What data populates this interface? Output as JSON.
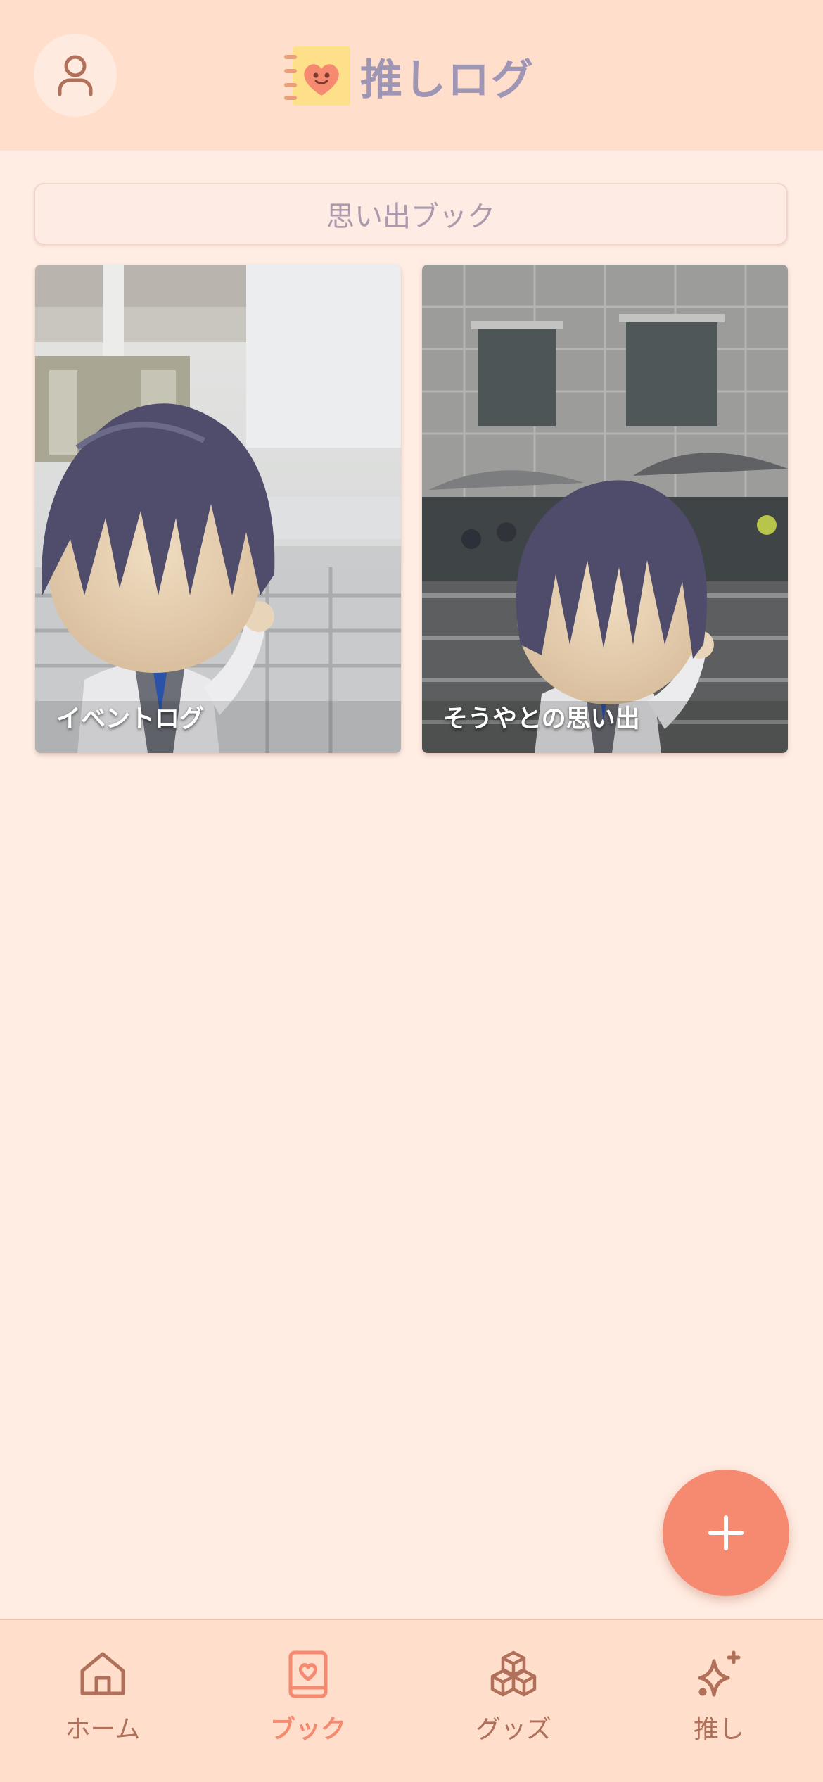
{
  "header": {
    "app_title": "推しログ",
    "profile_icon": "user-icon",
    "logo_icon": "heart-notebook-icon"
  },
  "section": {
    "title": "思い出ブック"
  },
  "books": [
    {
      "label": "イベントログ"
    },
    {
      "label": "そうやとの思い出"
    }
  ],
  "fab": {
    "icon": "plus-icon"
  },
  "bottom_nav": {
    "active": "book",
    "items": [
      {
        "label": "ホーム",
        "icon": "home-icon"
      },
      {
        "label": "ブック",
        "icon": "book-icon"
      },
      {
        "label": "グッズ",
        "icon": "boxes-icon"
      },
      {
        "label": "推し",
        "icon": "sparkles-icon"
      }
    ]
  },
  "colors": {
    "accent": "#f58a71",
    "header_bg": "#ffdfcc",
    "page_bg": "#ffece2",
    "title_text": "#9f95b4",
    "nav_inactive": "#b0705a"
  }
}
